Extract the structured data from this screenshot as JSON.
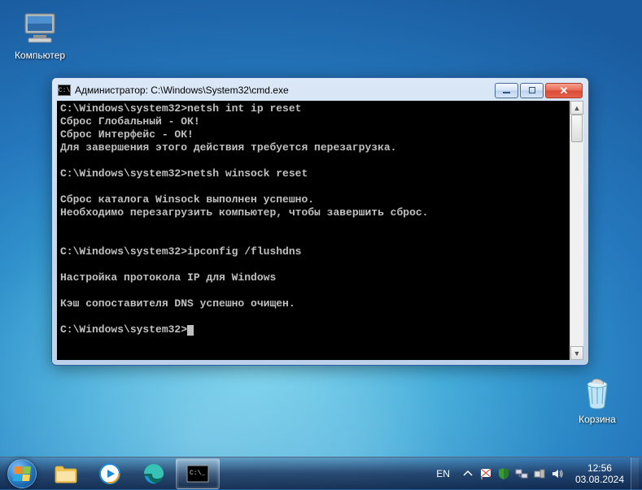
{
  "desktop": {
    "computer_label": "Компьютер",
    "recycle_label": "Корзина"
  },
  "window": {
    "title": "Администратор: C:\\Windows\\System32\\cmd.exe",
    "terminal_lines": [
      "C:\\Windows\\system32>netsh int ip reset",
      "Сброс Глобальный - ОК!",
      "Сброс Интерфейс - ОК!",
      "Для завершения этого действия требуется перезагрузка.",
      "",
      "C:\\Windows\\system32>netsh winsock reset",
      "",
      "Сброс каталога Winsock выполнен успешно.",
      "Необходимо перезагрузить компьютер, чтобы завершить сброс.",
      "",
      "",
      "C:\\Windows\\system32>ipconfig /flushdns",
      "",
      "Настройка протокола IP для Windows",
      "",
      "Кэш сопоставителя DNS успешно очищен.",
      "",
      "C:\\Windows\\system32>"
    ],
    "prompt_index": 17
  },
  "taskbar": {
    "lang": "EN",
    "time": "12:56",
    "date": "03.08.2024"
  }
}
